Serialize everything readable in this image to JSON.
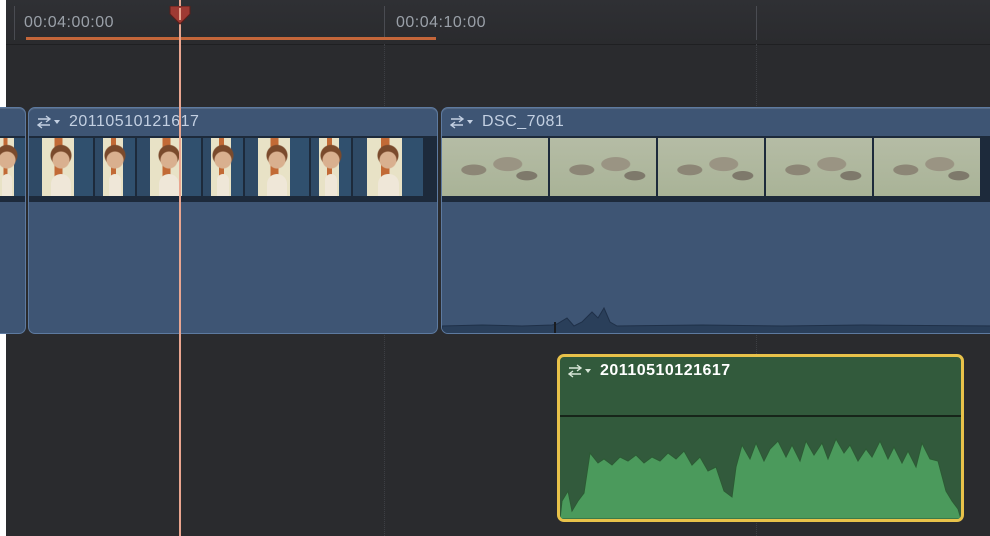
{
  "ruler": {
    "timecodes": [
      "00:04:00:00",
      "00:04:10:00"
    ]
  },
  "clips": {
    "left_stub": {},
    "video_1": {
      "title": "20110510121617",
      "icon": "clip-menu-icon",
      "frames": [
        "people",
        "people",
        "people",
        "people",
        "people",
        "people",
        "people"
      ]
    },
    "video_2": {
      "title": "DSC_7081",
      "icon": "clip-menu-icon",
      "frames": [
        "animals",
        "animals",
        "animals",
        "animals",
        "animals"
      ]
    },
    "audio_1": {
      "title": "20110510121617",
      "icon": "clip-menu-icon",
      "selected": true
    }
  },
  "colors": {
    "background": "#2a2b2e",
    "video_clip": "#3e5574",
    "audio_clip": "#325a3c",
    "selection": "#e8c24a",
    "playhead": "#e9a58f",
    "range": "#c4663a"
  }
}
